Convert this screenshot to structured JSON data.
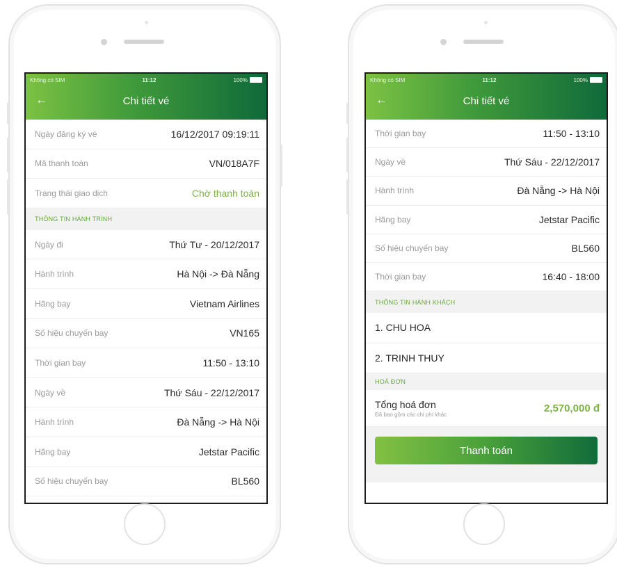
{
  "status": {
    "carrier": "Không có SIM",
    "time": "11:12",
    "battery": "100%"
  },
  "header": {
    "title": "Chi tiết vé"
  },
  "left": {
    "rows": [
      {
        "label": "Ngày đăng ký vé",
        "value": "16/12/2017 09:19:11"
      },
      {
        "label": "Mã thanh toán",
        "value": "VN/018A7F"
      },
      {
        "label": "Trạng thái giao dịch",
        "value": "Chờ thanh toán"
      }
    ],
    "section": "THÔNG TIN HÀNH TRÌNH",
    "trip_rows": [
      {
        "label": "Ngày đi",
        "value": "Thứ Tư - 20/12/2017"
      },
      {
        "label": "Hành trình",
        "value": "Hà Nội -> Đà Nẵng"
      },
      {
        "label": "Hãng bay",
        "value": "Vietnam Airlines"
      },
      {
        "label": "Số hiệu chuyến bay",
        "value": "VN165"
      },
      {
        "label": "Thời gian bay",
        "value": "11:50 - 13:10"
      },
      {
        "label": "Ngày về",
        "value": "Thứ Sáu - 22/12/2017"
      },
      {
        "label": "Hành trình",
        "value": "Đà Nẵng -> Hà Nội"
      },
      {
        "label": "Hãng bay",
        "value": "Jetstar Pacific"
      },
      {
        "label": "Số hiệu chuyến bay",
        "value": "BL560"
      }
    ]
  },
  "right": {
    "rows": [
      {
        "label": "Thời gian bay",
        "value": "11:50 - 13:10"
      },
      {
        "label": "Ngày về",
        "value": "Thứ Sáu - 22/12/2017"
      },
      {
        "label": "Hành trình",
        "value": "Đà Nẵng -> Hà Nội"
      },
      {
        "label": "Hãng bay",
        "value": "Jetstar Pacific"
      },
      {
        "label": "Số hiệu chuyến bay",
        "value": "BL560"
      },
      {
        "label": "Thời gian bay",
        "value": "16:40 - 18:00"
      }
    ],
    "section_passengers": "THÔNG TIN HÀNH KHÁCH",
    "passengers": [
      "1. CHU HOA",
      "2. TRINH THUY"
    ],
    "section_invoice": "HOÁ ĐƠN",
    "total_label": "Tổng hoá đơn",
    "total_note": "Đã bao gồm các chi phí khác",
    "total_value": "2,570,000 đ",
    "pay_button": "Thanh toán"
  },
  "colors": {
    "accent_green": "#7cb342",
    "header_dark": "#0f6a3a"
  }
}
